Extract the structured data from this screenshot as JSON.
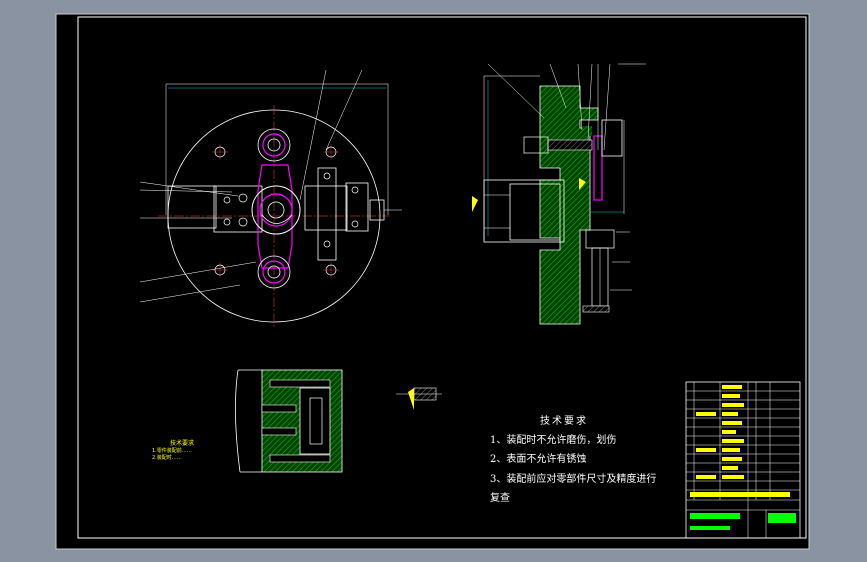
{
  "tech_requirements": {
    "title": "技术要求",
    "items": [
      "1、装配时不允许磨伤，划伤",
      "2、表面不允许有锈蚀",
      "3、装配前应对零部件尺寸及精度进行",
      "复查"
    ]
  },
  "yellow_note": {
    "title": "技术要求",
    "line1": "1.零件装配前……",
    "line2": "2.装配时……"
  },
  "colors": {
    "background": "#000000",
    "frame_outer": "#ffffff",
    "cyan_lines": "#00ffff",
    "magenta_parts": "#ff00ff",
    "green_hatch": "#00c000",
    "yellow_labels": "#ffff00",
    "white_lines": "#ffffff"
  }
}
